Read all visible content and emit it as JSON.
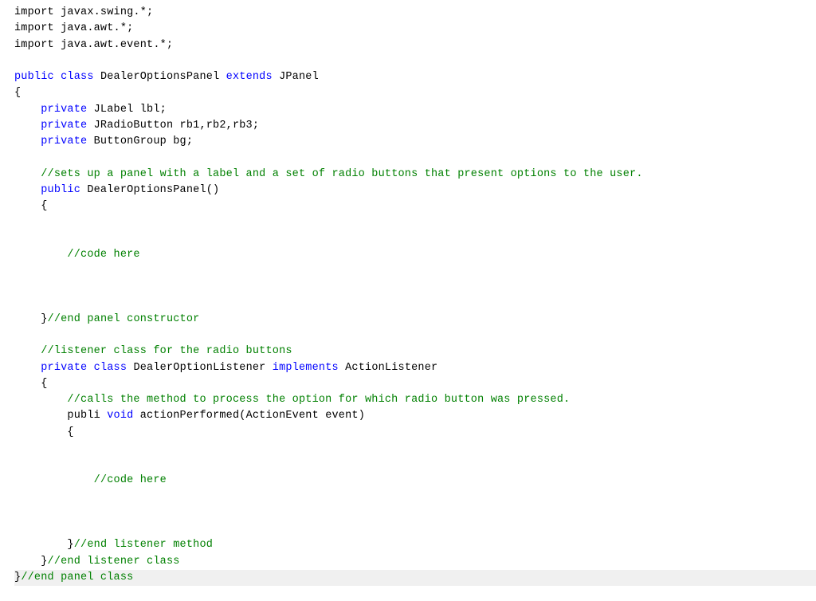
{
  "code": {
    "line1_import": "import",
    "line1_rest": " javax.swing.*;",
    "line2_import": "import",
    "line2_rest": " java.awt.*;",
    "line3_import": "import",
    "line3_rest": " java.awt.event.*;",
    "line5_public": "public",
    "line5_class": "class",
    "line5_rest": " DealerOptionsPanel ",
    "line5_extends": "extends",
    "line5_rest2": " JPanel",
    "lbrace": "{",
    "rbrace": "}",
    "indent1": "    ",
    "indent2": "        ",
    "indent3": "            ",
    "line7_private": "private",
    "line7_rest": " JLabel lbl;",
    "line8_private": "private",
    "line8_rest": " JRadioButton rb1,rb2,rb3;",
    "line9_private": "private",
    "line9_rest": " ButtonGroup bg;",
    "comment1": "//sets up a panel with a label and a set of radio buttons that present options to the user.",
    "line12_public": "public",
    "line12_rest": " DealerOptionsPanel()",
    "comment_code_here": "//code here",
    "comment_end_panel_constructor": "//end panel constructor",
    "comment_listener_class": "//listener class for the radio buttons",
    "line22_private": "private",
    "line22_class": "class",
    "line22_rest": " DealerOptionListener ",
    "line22_implements": "implements",
    "line22_rest2": " ActionListener",
    "comment_calls": "//calls the method to process the option for which radio button was pressed.",
    "line25_publi": "publi ",
    "line25_void": "void",
    "line25_rest": " actionPerformed(ActionEvent event)",
    "comment_end_listener_method": "//end listener method",
    "comment_end_listener_class": "//end listener class",
    "comment_end_panel_class": "//end panel class"
  }
}
